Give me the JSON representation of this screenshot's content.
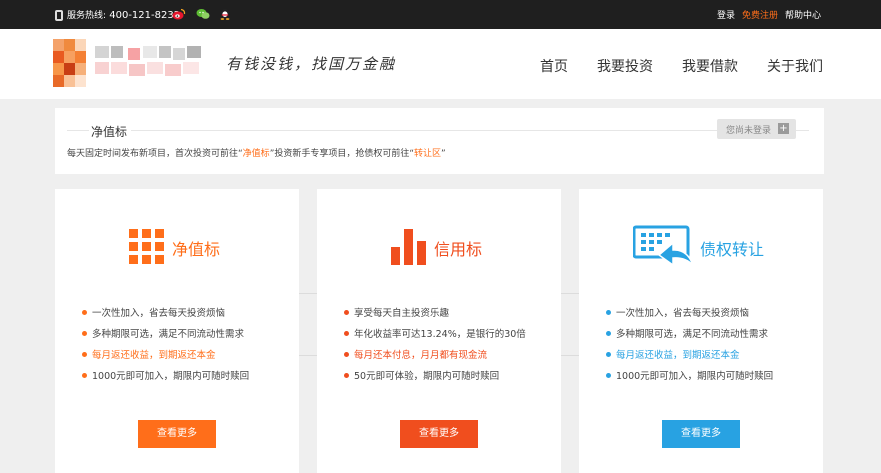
{
  "topbar": {
    "hotline_label": "服务热线:",
    "hotline_number": "400-121-8232",
    "social_icons": [
      "weibo-icon",
      "wechat-icon",
      "qq-icon"
    ],
    "login": "登录",
    "register": "免费注册",
    "help": "帮助中心"
  },
  "header": {
    "slogan": "有钱没钱，找国万金融",
    "nav": [
      "首页",
      "我要投资",
      "我要借款",
      "关于我们"
    ]
  },
  "intro": {
    "title": "净值标",
    "login_prompt": "您尚未登录",
    "desc_pre": "每天固定时间发布新项目，首次投资可前往“",
    "desc_link1": "净值标",
    "desc_mid": "”投资新手专享项目，抢债权可前往“",
    "desc_link2": "转让区",
    "desc_post": "”"
  },
  "colors": {
    "orange": "#ff6e1a",
    "red": "#f04e1e",
    "blue": "#28a2e2",
    "dark": "#1f1f1f"
  },
  "cards": [
    {
      "title": "净值标",
      "icon": "grid-icon",
      "color": "#ff6e1a",
      "bullets": [
        "一次性加入，省去每天投资烦恼",
        "多种期限可选，满足不同流动性需求",
        "每月返还收益，到期返还本金",
        "1000元即可加入，期限内可随时赎回"
      ],
      "button": "查看更多"
    },
    {
      "title": "信用标",
      "icon": "bar-chart-icon",
      "color": "#f04e1e",
      "bullets": [
        "享受每天自主投资乐趣",
        "年化收益率可达13.24%，是银行的30倍",
        "每月还本付息，月月都有现金流",
        "50元即可体验，期限内可随时赎回"
      ],
      "button": "查看更多"
    },
    {
      "title": "债权转让",
      "icon": "transfer-icon",
      "color": "#28a2e2",
      "bullets": [
        "一次性加入，省去每天投资烦恼",
        "多种期限可选，满足不同流动性需求",
        "每月返还收益，到期返还本金",
        "1000元即可加入，期限内可随时赎回"
      ],
      "button": "查看更多"
    }
  ]
}
